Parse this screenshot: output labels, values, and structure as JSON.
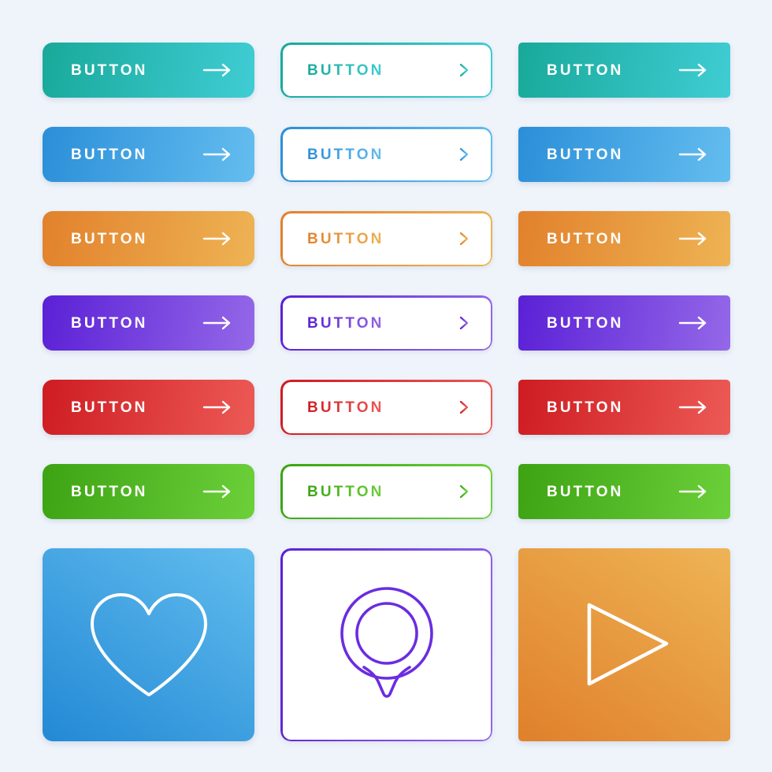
{
  "page": {
    "title": "Modern Gradient Button Set",
    "background_color": "#eff4fb",
    "columns": 3,
    "rows": 7
  },
  "labels": {
    "button": "BUTTON"
  },
  "palette": {
    "teal": {
      "name": "teal",
      "from": "#19a99a",
      "to": "#3fcdd4"
    },
    "blue": {
      "name": "blue",
      "from": "#2b8fd8",
      "to": "#64bdef"
    },
    "orange": {
      "name": "orange",
      "from": "#e2812c",
      "to": "#eeb354"
    },
    "purple": {
      "name": "purple",
      "from": "#5b20d6",
      "to": "#9468e8"
    },
    "red": {
      "name": "red",
      "from": "#ce1c22",
      "to": "#ec5a55"
    },
    "green": {
      "name": "green",
      "from": "#3da313",
      "to": "#6cd03a"
    },
    "white": {
      "name": "white",
      "from": "#ffffff",
      "to": "#ffffff"
    }
  },
  "rows": [
    {
      "color": "teal",
      "buttons": [
        {
          "label": "BUTTON",
          "style": "solid",
          "radius": "large",
          "icon": "arrow-right-icon"
        },
        {
          "label": "BUTTON",
          "style": "outline",
          "radius": "large",
          "icon": "arrow-right-icon"
        },
        {
          "label": "BUTTON",
          "style": "solid",
          "radius": "small",
          "icon": "arrow-right-icon"
        }
      ]
    },
    {
      "color": "blue",
      "buttons": [
        {
          "label": "BUTTON",
          "style": "solid",
          "radius": "large",
          "icon": "arrow-right-icon"
        },
        {
          "label": "BUTTON",
          "style": "outline",
          "radius": "large",
          "icon": "arrow-right-icon"
        },
        {
          "label": "BUTTON",
          "style": "solid",
          "radius": "small",
          "icon": "arrow-right-icon"
        }
      ]
    },
    {
      "color": "orange",
      "buttons": [
        {
          "label": "BUTTON",
          "style": "solid",
          "radius": "large",
          "icon": "arrow-right-icon"
        },
        {
          "label": "BUTTON",
          "style": "outline",
          "radius": "large",
          "icon": "arrow-right-icon"
        },
        {
          "label": "BUTTON",
          "style": "solid",
          "radius": "small",
          "icon": "arrow-right-icon"
        }
      ]
    },
    {
      "color": "purple",
      "buttons": [
        {
          "label": "BUTTON",
          "style": "solid",
          "radius": "large",
          "icon": "arrow-right-icon"
        },
        {
          "label": "BUTTON",
          "style": "outline",
          "radius": "large",
          "icon": "arrow-right-icon"
        },
        {
          "label": "BUTTON",
          "style": "solid",
          "radius": "small",
          "icon": "arrow-right-icon"
        }
      ]
    },
    {
      "color": "red",
      "buttons": [
        {
          "label": "BUTTON",
          "style": "solid",
          "radius": "large",
          "icon": "arrow-right-icon"
        },
        {
          "label": "BUTTON",
          "style": "outline",
          "radius": "large",
          "icon": "arrow-right-icon"
        },
        {
          "label": "BUTTON",
          "style": "solid",
          "radius": "small",
          "icon": "arrow-right-icon"
        }
      ]
    },
    {
      "color": "green",
      "buttons": [
        {
          "label": "BUTTON",
          "style": "solid",
          "radius": "large",
          "icon": "arrow-right-icon"
        },
        {
          "label": "BUTTON",
          "style": "outline",
          "radius": "large",
          "icon": "arrow-right-icon"
        },
        {
          "label": "BUTTON",
          "style": "solid",
          "radius": "small",
          "icon": "arrow-right-icon"
        }
      ]
    }
  ],
  "icon_cards": [
    {
      "icon": "heart-icon",
      "color": "blue",
      "style": "solid",
      "radius": "large",
      "icon_color": "#ffffff"
    },
    {
      "icon": "map-pin-icon",
      "color": "purple",
      "style": "outline",
      "radius": "large",
      "icon_color": "#6a2de0"
    },
    {
      "icon": "play-icon",
      "color": "orange",
      "style": "solid",
      "radius": "small",
      "icon_color": "#ffffff"
    }
  ]
}
